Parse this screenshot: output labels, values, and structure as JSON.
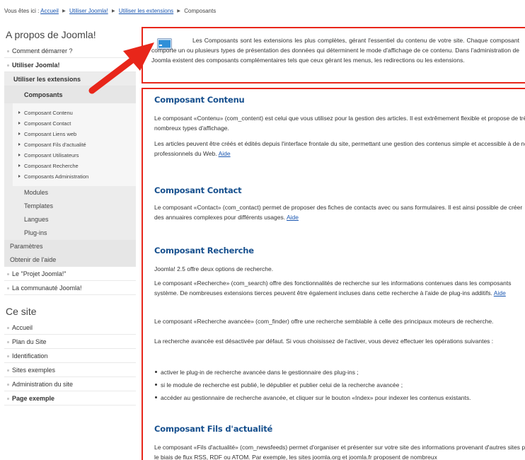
{
  "breadcrumb": {
    "prefix": "Vous êtes ici :",
    "links": [
      "Accueil",
      "Utiliser Joomla!",
      "Utiliser les extensions"
    ],
    "current": "Composants"
  },
  "sidebar": {
    "section1": {
      "heading": "A propos de Joomla!",
      "top_items": [
        "Comment démarrer ?",
        "Utiliser Joomla!"
      ],
      "extensions_label": "Utiliser les extensions",
      "active_label": "Composants",
      "components": [
        "Composant Contenu",
        "Composant Contact",
        "Composant Liens web",
        "Composant Fils d'actualité",
        "Composant Utilisateurs",
        "Composant Recherche",
        "Composants Administration"
      ],
      "extension_items": [
        "Modules",
        "Templates",
        "Langues",
        "Plug-ins"
      ],
      "level2_items": [
        "Paramètres",
        "Obtenir de l'aide"
      ],
      "bottom_items": [
        "Le \"Projet Joomla!\"",
        "La communauté Joomla!"
      ]
    },
    "section2": {
      "heading": "Ce site",
      "items": [
        "Accueil",
        "Plan du Site",
        "Identification",
        "Sites exemples",
        "Administration du site",
        "Page exemple"
      ]
    }
  },
  "intro": {
    "text": "Les Composants sont les extensions les plus complètes, gérant l'essentiel du contenu de votre site. Chaque composant comporte un ou plusieurs types de présentation des données qui déterminent le mode d'affichage de ce contenu. Dans l'administration de Joomla existent des composants complémentaires tels que ceux gérant les menus, les redirections ou les extensions."
  },
  "sections": {
    "contenu": {
      "title": "Composant Contenu",
      "p1": "Le composant «Contenu» (com_content) est celui que vous utilisez pour la gestion des articles. Il est extrêmement flexible et propose de très nombreux types d'affichage.",
      "p2": "Les articles peuvent être créés et édités depuis l'interface frontale du site, permettant une gestion des contenus simple et accessible à de non professionnels du Web.",
      "help": "Aide"
    },
    "contact": {
      "title": "Composant Contact",
      "p1": "Le composant «Contact» (com_contact) permet de proposer des fiches de contacts avec ou sans formulaires. Il est ainsi possible de créer des annuaires complexes pour différents usages.",
      "help": "Aide"
    },
    "recherche": {
      "title": "Composant Recherche",
      "p1": "Joomla! 2.5 offre deux options de recherche.",
      "p2": "Le composant «Recherche» (com_search) offre des fonctionnalités de recherche sur les informations contenues dans les composants système. De nombreuses extensions tierces peuvent être également incluses dans cette recherche à l'aide de plug-ins additifs.",
      "help": "Aide",
      "p3": "Le composant «Recherche avancée» (com_finder) offre une recherche semblable à celle des principaux moteurs de recherche.",
      "p4": "La recherche avancée est désactivée par défaut. Si vous choisissez de l'activer, vous devez effectuer les opérations suivantes :",
      "bullets": [
        "activer le plug-in de recherche avancée dans le gestionnaire des plug-ins ;",
        "si le module de recherche est publié, le dépublier et publier celui de la recherche avancée ;",
        "accéder au gestionnaire de recherche avancée, et cliquer sur le bouton «Index» pour indexer les contenus existants."
      ]
    },
    "fils": {
      "title": "Composant Fils d'actualité",
      "p1": "Le composant «Fils d'actualité» (com_newsfeeds) permet d'organiser et présenter sur votre site des informations provenant d'autres sites par le biais de flux RSS, RDF ou ATOM. Par exemple, les sites joomla.org et joomla.fr proposent de nombreux"
    }
  },
  "colors": {
    "highlight": "#e8261a",
    "heading": "#17508e",
    "link": "#1b57b1"
  }
}
